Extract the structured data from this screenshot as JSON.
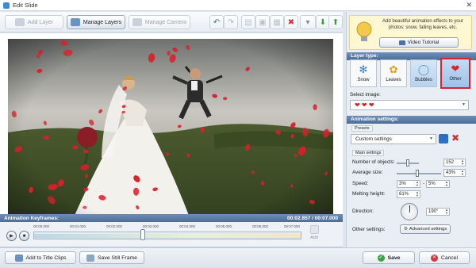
{
  "window": {
    "title": "Edit Slide",
    "close_glyph": "✕"
  },
  "toolbar": {
    "add_layer": "Add Layer",
    "manage_layers": "Manage Layers",
    "manage_camera": "Manage Camera",
    "undo_glyph": "↶",
    "redo_glyph": "↷",
    "delete_glyph": "✖"
  },
  "keyframes": {
    "title": "Animation Keyframes:",
    "time": "00:02.857 / 00:07.000",
    "ticks": [
      "00:00.000",
      "00:01.000",
      "00:02.000",
      "00:03.000",
      "00:04.000",
      "00:05.000",
      "00:06.000",
      "00:07.000"
    ],
    "add_label": "Add",
    "play_glyph": "▶",
    "stop_glyph": "■",
    "progress_fraction": 0.408
  },
  "bottom": {
    "add_title_clips": "Add to Title Clips",
    "save_still_frame": "Save Still Frame",
    "save": "Save",
    "cancel": "Cancel"
  },
  "panel": {
    "tip": "Add beautiful animation effects to your photos: snow, falling leaves, etc.",
    "video_tutorial": "Video Tutorial",
    "layer_type_title": "Layer type:",
    "layer_types": [
      {
        "label": "Snow",
        "icon": "snowflake-icon",
        "glyph": "✻",
        "color": "#3d7dc4"
      },
      {
        "label": "Leaves",
        "icon": "leaf-icon",
        "glyph": "✿",
        "color": "#e49a1a"
      },
      {
        "label": "Bubbles",
        "icon": "bubble-icon",
        "glyph": "◯",
        "color": "#4b9bd8"
      },
      {
        "label": "Other",
        "icon": "shapes-icon",
        "glyph": "❤",
        "color": "#d8262b"
      }
    ],
    "select_image_label": "Select image:",
    "select_image_value": "❤ ❤ ❤",
    "animation_settings_title": "Animation settings:",
    "presets_label": "Presets",
    "presets_value": "Custom settings",
    "main_settings_label": "Main settings",
    "settings": {
      "number_label": "Number of objects:",
      "number_value": "152",
      "avg_size_label": "Average size:",
      "avg_size_value": "43%",
      "speed_label": "Speed:",
      "speed_from": "3%",
      "speed_dash": "-",
      "speed_to": "5%",
      "melting_label": "Melting height:",
      "melting_value": "61%",
      "direction_label": "Direction:",
      "direction_value": "190°",
      "other_label": "Other settings:",
      "advanced_button": "Advanced settings"
    }
  },
  "colors": {
    "accent": "#4b6e99",
    "selection": "#d5252b",
    "petal": "#d9202a"
  }
}
